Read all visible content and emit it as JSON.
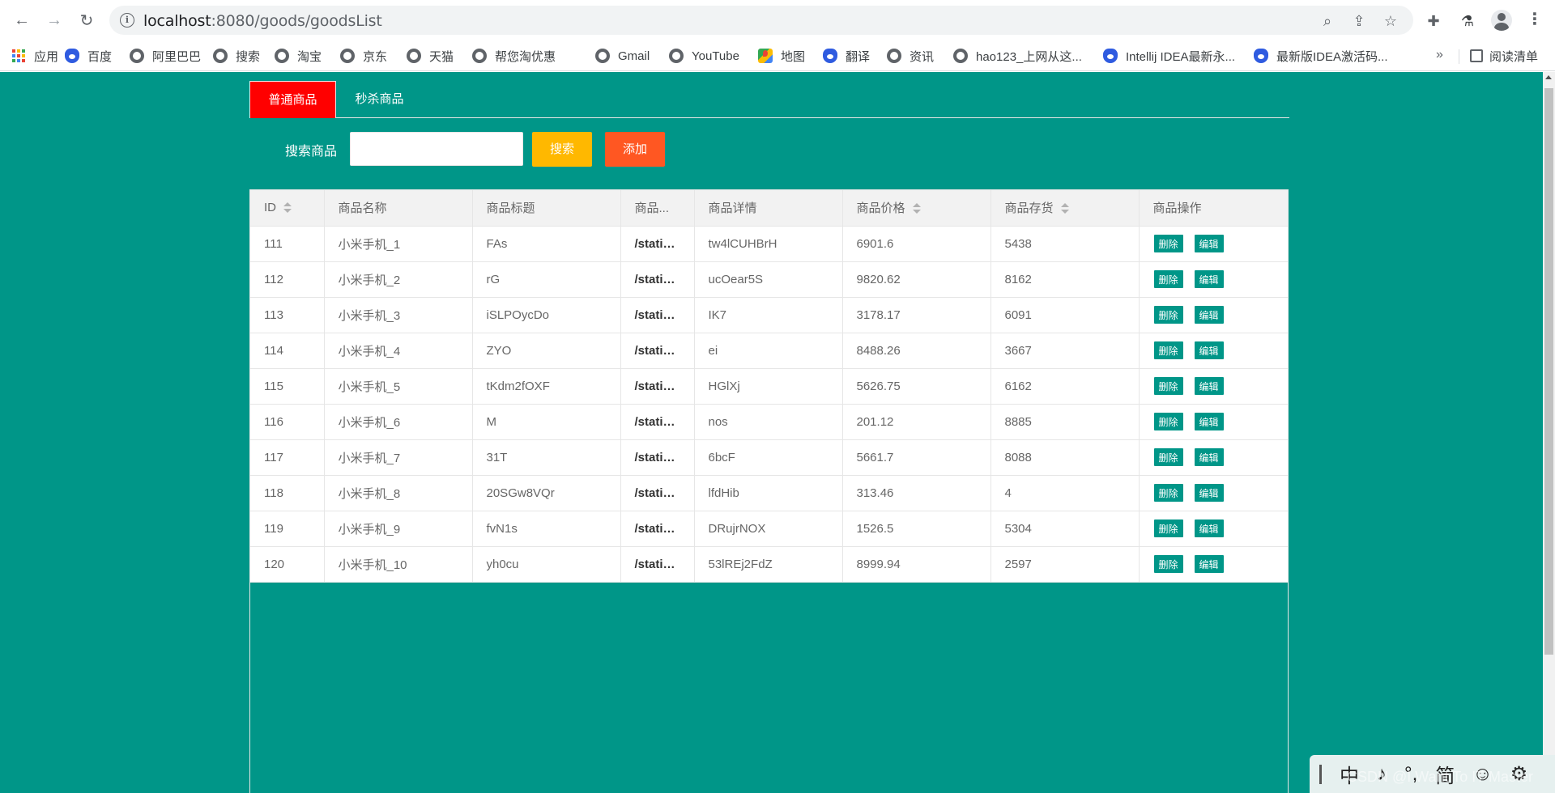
{
  "browser": {
    "url_host": "localhost",
    "url_rest": ":8080/goods/goodsList",
    "bookmarks": [
      {
        "label": "应用",
        "icon": "apps-icon"
      },
      {
        "label": "百度",
        "icon": "baidu-icon"
      },
      {
        "label": "阿里巴巴",
        "icon": "globe-icon"
      },
      {
        "label": "搜索",
        "icon": "globe-icon"
      },
      {
        "label": "淘宝",
        "icon": "globe-icon"
      },
      {
        "label": "京东",
        "icon": "globe-icon"
      },
      {
        "label": "天猫",
        "icon": "globe-icon"
      },
      {
        "label": "帮您淘优惠",
        "icon": "globe-icon"
      },
      {
        "label": "Gmail",
        "icon": "globe-icon"
      },
      {
        "label": "YouTube",
        "icon": "globe-icon"
      },
      {
        "label": "地图",
        "icon": "maps-icon"
      },
      {
        "label": "翻译",
        "icon": "baidu-icon"
      },
      {
        "label": "资讯",
        "icon": "globe-icon"
      },
      {
        "label": "hao123_上网从这...",
        "icon": "globe-icon"
      },
      {
        "label": "Intellij IDEA最新永...",
        "icon": "baidu-icon"
      },
      {
        "label": "最新版IDEA激活码...",
        "icon": "baidu-icon"
      }
    ],
    "more": "»",
    "reading_list": "阅读清单"
  },
  "tabs": [
    {
      "label": "普通商品",
      "active": true
    },
    {
      "label": "秒杀商品",
      "active": false
    }
  ],
  "search": {
    "label": "搜索商品",
    "value": "",
    "search_button": "搜索",
    "add_button": "添加"
  },
  "table": {
    "headers": [
      "ID",
      "商品名称",
      "商品标题",
      "商品...",
      "商品详情",
      "商品价格",
      "商品存货",
      "商品操作"
    ],
    "delete_label": "删除",
    "edit_label": "编辑",
    "rows": [
      {
        "id": "111",
        "name": "小米手机_1",
        "title": "FAs",
        "img": "/static/...",
        "detail": "tw4lCUHBrH",
        "price": "6901.6",
        "stock": "5438"
      },
      {
        "id": "112",
        "name": "小米手机_2",
        "title": "rG",
        "img": "/static/...",
        "detail": "ucOear5S",
        "price": "9820.62",
        "stock": "8162"
      },
      {
        "id": "113",
        "name": "小米手机_3",
        "title": "iSLPOycDo",
        "img": "/static/...",
        "detail": "IK7",
        "price": "3178.17",
        "stock": "6091"
      },
      {
        "id": "114",
        "name": "小米手机_4",
        "title": "ZYO",
        "img": "/static/...",
        "detail": "ei",
        "price": "8488.26",
        "stock": "3667"
      },
      {
        "id": "115",
        "name": "小米手机_5",
        "title": "tKdm2fOXF",
        "img": "/static/...",
        "detail": "HGlXj",
        "price": "5626.75",
        "stock": "6162"
      },
      {
        "id": "116",
        "name": "小米手机_6",
        "title": "M",
        "img": "/static/...",
        "detail": "nos",
        "price": "201.12",
        "stock": "8885"
      },
      {
        "id": "117",
        "name": "小米手机_7",
        "title": "31T",
        "img": "/static/...",
        "detail": "6bcF",
        "price": "5661.7",
        "stock": "8088"
      },
      {
        "id": "118",
        "name": "小米手机_8",
        "title": "20SGw8VQr",
        "img": "/static/...",
        "detail": "lfdHib",
        "price": "313.46",
        "stock": "4"
      },
      {
        "id": "119",
        "name": "小米手机_9",
        "title": "fvN1s",
        "img": "/static/...",
        "detail": "DRujrNOX",
        "price": "1526.5",
        "stock": "5304"
      },
      {
        "id": "120",
        "name": "小米手机_10",
        "title": "yh0cu",
        "img": "/static/...",
        "detail": "53lREj2FdZ",
        "price": "8999.94",
        "stock": "2597"
      }
    ]
  },
  "ime": {
    "items": [
      "中",
      "♪",
      "°,",
      "简",
      "☺",
      "⚙"
    ],
    "watermark": "CSDN @I Want To IT Master"
  },
  "colors": {
    "page_bg": "#009688",
    "active_tab": "#ff0000",
    "search_button": "#ffb800",
    "add_button": "#ff5722"
  }
}
